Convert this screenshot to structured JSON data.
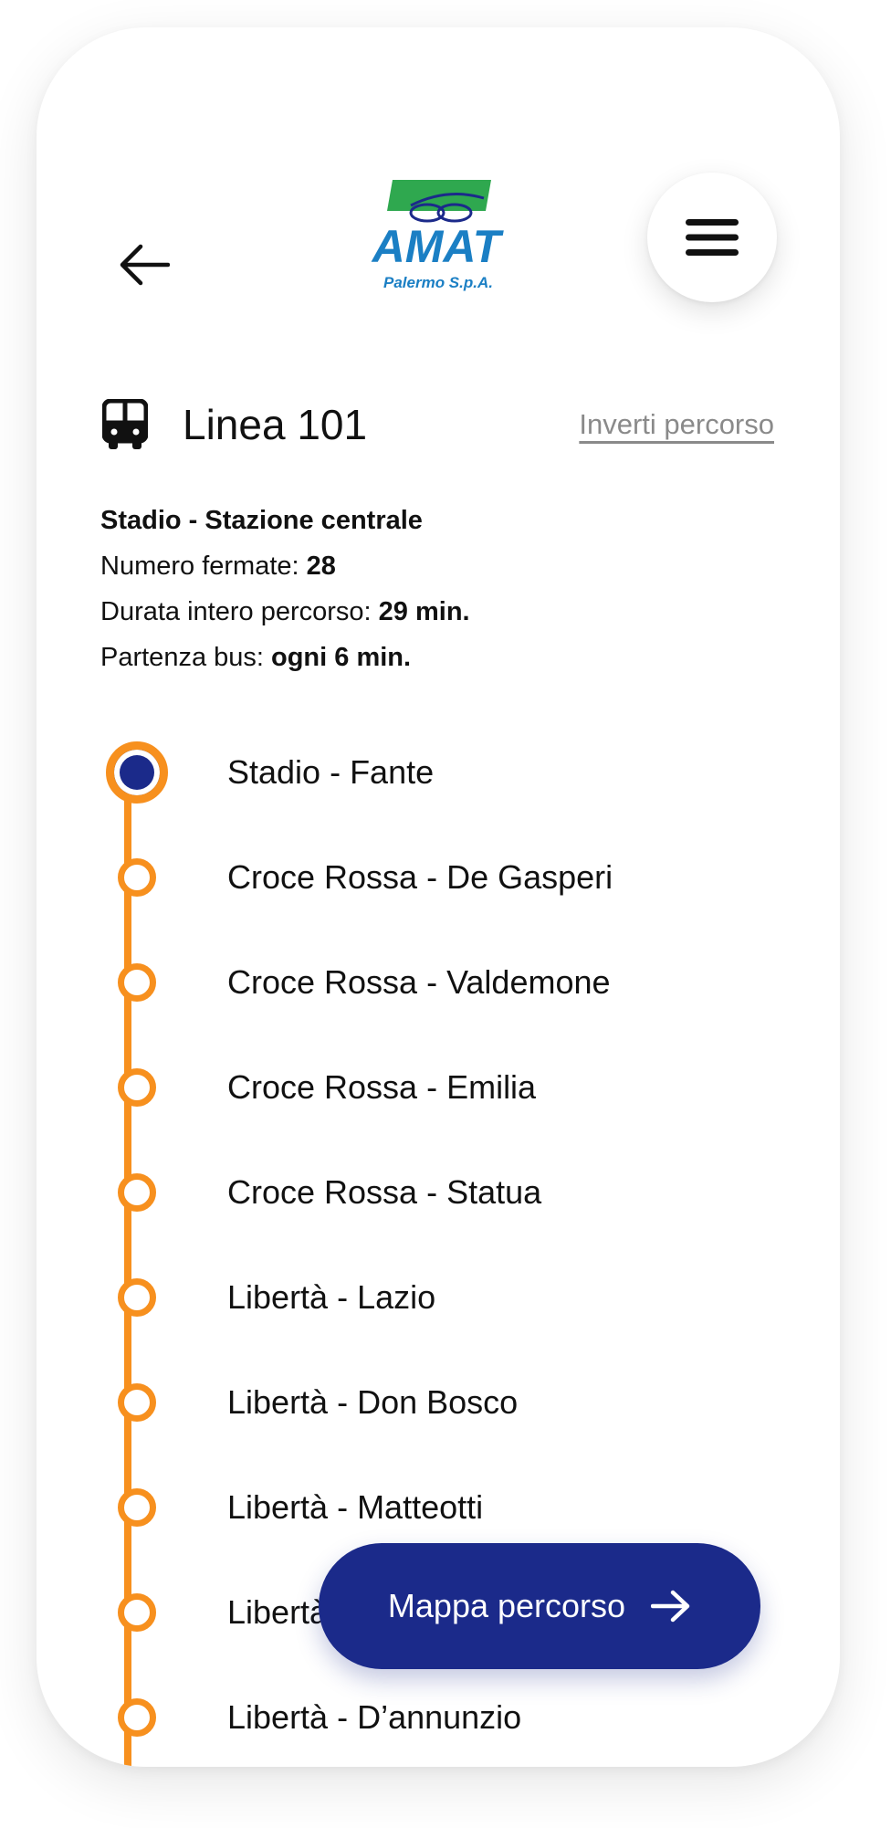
{
  "header": {
    "logo": {
      "brand": "AMAT",
      "subtitle": "Palermo S.p.A."
    }
  },
  "line": {
    "title": "Linea 101",
    "invert_label": "Inverti percorso"
  },
  "info": {
    "route": "Stadio - Stazione centrale",
    "stops_label": "Numero fermate: ",
    "stops_value": "28",
    "duration_label": "Durata intero percorso: ",
    "duration_value": "29 min.",
    "departure_label": "Partenza bus: ",
    "departure_value": "ogni 6 min."
  },
  "stops": [
    "Stadio - Fante",
    "Croce Rossa - De Gasperi",
    "Croce Rossa - Valdemone",
    "Croce Rossa - Emilia",
    "Croce Rossa - Statua",
    "Libertà - Lazio",
    "Libertà - Don Bosco",
    "Libertà - Matteotti",
    "Libertà - ",
    "Libertà - D’annunzio"
  ],
  "map_button": {
    "label": "Mappa percorso"
  },
  "icons": {
    "back": "back-arrow-icon",
    "menu": "hamburger-menu-icon",
    "bus": "bus-icon",
    "map_arrow": "arrow-right-icon"
  },
  "colors": {
    "accent_orange": "#F7901E",
    "primary_blue": "#1B2A8A",
    "link_gray": "#8a8a8a"
  }
}
